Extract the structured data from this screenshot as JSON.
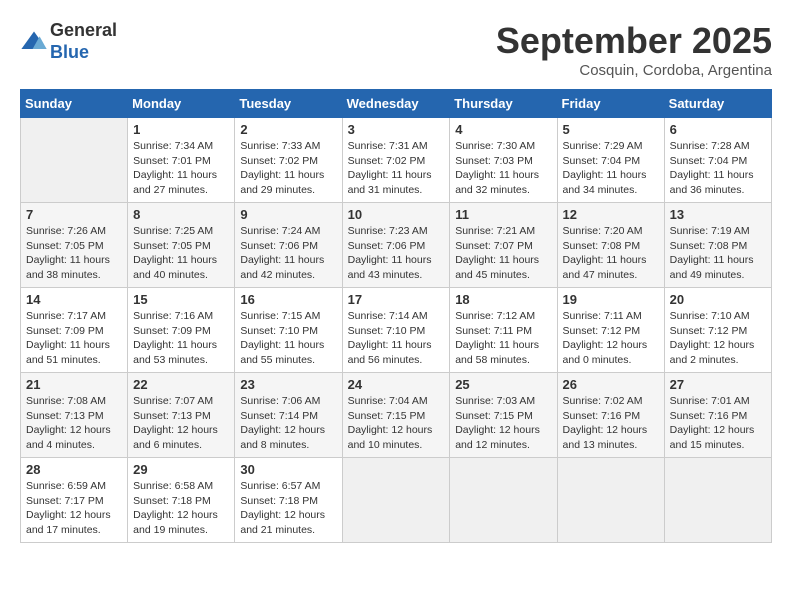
{
  "header": {
    "logo_line1": "General",
    "logo_line2": "Blue",
    "month_title": "September 2025",
    "location": "Cosquin, Cordoba, Argentina"
  },
  "weekdays": [
    "Sunday",
    "Monday",
    "Tuesday",
    "Wednesday",
    "Thursday",
    "Friday",
    "Saturday"
  ],
  "weeks": [
    [
      {
        "num": "",
        "sunrise": "",
        "sunset": "",
        "daylight": ""
      },
      {
        "num": "1",
        "sunrise": "Sunrise: 7:34 AM",
        "sunset": "Sunset: 7:01 PM",
        "daylight": "Daylight: 11 hours and 27 minutes."
      },
      {
        "num": "2",
        "sunrise": "Sunrise: 7:33 AM",
        "sunset": "Sunset: 7:02 PM",
        "daylight": "Daylight: 11 hours and 29 minutes."
      },
      {
        "num": "3",
        "sunrise": "Sunrise: 7:31 AM",
        "sunset": "Sunset: 7:02 PM",
        "daylight": "Daylight: 11 hours and 31 minutes."
      },
      {
        "num": "4",
        "sunrise": "Sunrise: 7:30 AM",
        "sunset": "Sunset: 7:03 PM",
        "daylight": "Daylight: 11 hours and 32 minutes."
      },
      {
        "num": "5",
        "sunrise": "Sunrise: 7:29 AM",
        "sunset": "Sunset: 7:04 PM",
        "daylight": "Daylight: 11 hours and 34 minutes."
      },
      {
        "num": "6",
        "sunrise": "Sunrise: 7:28 AM",
        "sunset": "Sunset: 7:04 PM",
        "daylight": "Daylight: 11 hours and 36 minutes."
      }
    ],
    [
      {
        "num": "7",
        "sunrise": "Sunrise: 7:26 AM",
        "sunset": "Sunset: 7:05 PM",
        "daylight": "Daylight: 11 hours and 38 minutes."
      },
      {
        "num": "8",
        "sunrise": "Sunrise: 7:25 AM",
        "sunset": "Sunset: 7:05 PM",
        "daylight": "Daylight: 11 hours and 40 minutes."
      },
      {
        "num": "9",
        "sunrise": "Sunrise: 7:24 AM",
        "sunset": "Sunset: 7:06 PM",
        "daylight": "Daylight: 11 hours and 42 minutes."
      },
      {
        "num": "10",
        "sunrise": "Sunrise: 7:23 AM",
        "sunset": "Sunset: 7:06 PM",
        "daylight": "Daylight: 11 hours and 43 minutes."
      },
      {
        "num": "11",
        "sunrise": "Sunrise: 7:21 AM",
        "sunset": "Sunset: 7:07 PM",
        "daylight": "Daylight: 11 hours and 45 minutes."
      },
      {
        "num": "12",
        "sunrise": "Sunrise: 7:20 AM",
        "sunset": "Sunset: 7:08 PM",
        "daylight": "Daylight: 11 hours and 47 minutes."
      },
      {
        "num": "13",
        "sunrise": "Sunrise: 7:19 AM",
        "sunset": "Sunset: 7:08 PM",
        "daylight": "Daylight: 11 hours and 49 minutes."
      }
    ],
    [
      {
        "num": "14",
        "sunrise": "Sunrise: 7:17 AM",
        "sunset": "Sunset: 7:09 PM",
        "daylight": "Daylight: 11 hours and 51 minutes."
      },
      {
        "num": "15",
        "sunrise": "Sunrise: 7:16 AM",
        "sunset": "Sunset: 7:09 PM",
        "daylight": "Daylight: 11 hours and 53 minutes."
      },
      {
        "num": "16",
        "sunrise": "Sunrise: 7:15 AM",
        "sunset": "Sunset: 7:10 PM",
        "daylight": "Daylight: 11 hours and 55 minutes."
      },
      {
        "num": "17",
        "sunrise": "Sunrise: 7:14 AM",
        "sunset": "Sunset: 7:10 PM",
        "daylight": "Daylight: 11 hours and 56 minutes."
      },
      {
        "num": "18",
        "sunrise": "Sunrise: 7:12 AM",
        "sunset": "Sunset: 7:11 PM",
        "daylight": "Daylight: 11 hours and 58 minutes."
      },
      {
        "num": "19",
        "sunrise": "Sunrise: 7:11 AM",
        "sunset": "Sunset: 7:12 PM",
        "daylight": "Daylight: 12 hours and 0 minutes."
      },
      {
        "num": "20",
        "sunrise": "Sunrise: 7:10 AM",
        "sunset": "Sunset: 7:12 PM",
        "daylight": "Daylight: 12 hours and 2 minutes."
      }
    ],
    [
      {
        "num": "21",
        "sunrise": "Sunrise: 7:08 AM",
        "sunset": "Sunset: 7:13 PM",
        "daylight": "Daylight: 12 hours and 4 minutes."
      },
      {
        "num": "22",
        "sunrise": "Sunrise: 7:07 AM",
        "sunset": "Sunset: 7:13 PM",
        "daylight": "Daylight: 12 hours and 6 minutes."
      },
      {
        "num": "23",
        "sunrise": "Sunrise: 7:06 AM",
        "sunset": "Sunset: 7:14 PM",
        "daylight": "Daylight: 12 hours and 8 minutes."
      },
      {
        "num": "24",
        "sunrise": "Sunrise: 7:04 AM",
        "sunset": "Sunset: 7:15 PM",
        "daylight": "Daylight: 12 hours and 10 minutes."
      },
      {
        "num": "25",
        "sunrise": "Sunrise: 7:03 AM",
        "sunset": "Sunset: 7:15 PM",
        "daylight": "Daylight: 12 hours and 12 minutes."
      },
      {
        "num": "26",
        "sunrise": "Sunrise: 7:02 AM",
        "sunset": "Sunset: 7:16 PM",
        "daylight": "Daylight: 12 hours and 13 minutes."
      },
      {
        "num": "27",
        "sunrise": "Sunrise: 7:01 AM",
        "sunset": "Sunset: 7:16 PM",
        "daylight": "Daylight: 12 hours and 15 minutes."
      }
    ],
    [
      {
        "num": "28",
        "sunrise": "Sunrise: 6:59 AM",
        "sunset": "Sunset: 7:17 PM",
        "daylight": "Daylight: 12 hours and 17 minutes."
      },
      {
        "num": "29",
        "sunrise": "Sunrise: 6:58 AM",
        "sunset": "Sunset: 7:18 PM",
        "daylight": "Daylight: 12 hours and 19 minutes."
      },
      {
        "num": "30",
        "sunrise": "Sunrise: 6:57 AM",
        "sunset": "Sunset: 7:18 PM",
        "daylight": "Daylight: 12 hours and 21 minutes."
      },
      {
        "num": "",
        "sunrise": "",
        "sunset": "",
        "daylight": ""
      },
      {
        "num": "",
        "sunrise": "",
        "sunset": "",
        "daylight": ""
      },
      {
        "num": "",
        "sunrise": "",
        "sunset": "",
        "daylight": ""
      },
      {
        "num": "",
        "sunrise": "",
        "sunset": "",
        "daylight": ""
      }
    ]
  ]
}
